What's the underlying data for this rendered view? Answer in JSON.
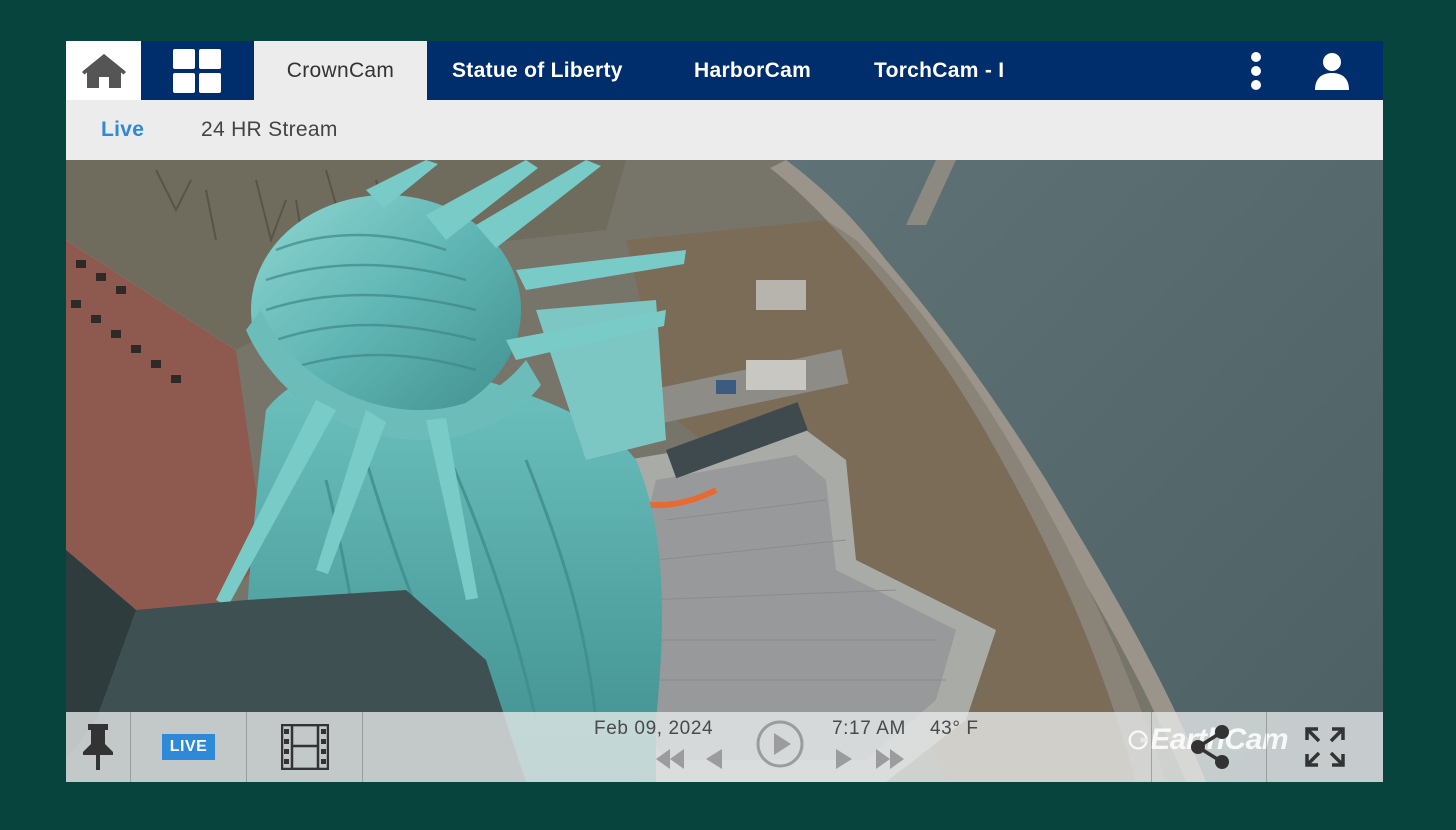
{
  "nav": {
    "home_icon": "home-icon",
    "grid_icon": "grid-icon",
    "tabs": [
      {
        "label": "CrownCam",
        "active": true
      },
      {
        "label": "Statue of Liberty",
        "active": false
      },
      {
        "label": "HarborCam",
        "active": false
      },
      {
        "label": "TorchCam - I",
        "active": false
      }
    ],
    "menu_icon": "kebab-menu-icon",
    "user_icon": "user-icon"
  },
  "subnav": {
    "live_label": "Live",
    "stream_label": "24 HR Stream"
  },
  "controls": {
    "pin_icon": "pin-icon",
    "live_badge": "LIVE",
    "film_icon": "film-icon",
    "date": "Feb 09, 2024",
    "time": "7:17 AM",
    "temperature": "43° F",
    "watermark": "EarthCam",
    "share_icon": "share-icon",
    "fullscreen_icon": "fullscreen-icon"
  },
  "colors": {
    "background": "#07443e",
    "nav_bar": "#002d6b",
    "accent_blue": "#2e8ad8",
    "subnav_bg": "#ececec"
  }
}
